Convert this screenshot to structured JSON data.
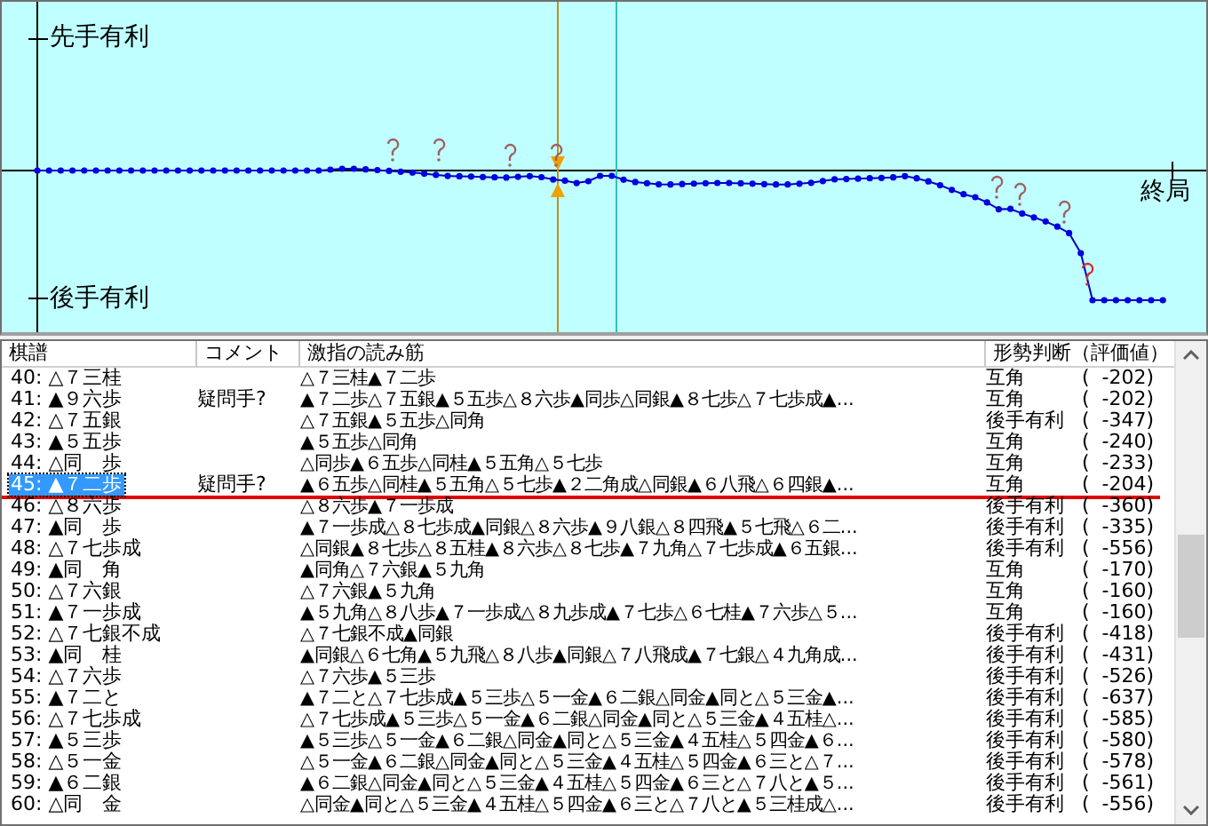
{
  "graph": {
    "upper_label": "先手有利",
    "lower_label": "後手有利",
    "end_label": "終局"
  },
  "table": {
    "columns": [
      "棋譜",
      "コメント",
      "激指の読み筋",
      "形勢判断（評価値）"
    ],
    "rows": [
      {
        "move": "40: △７三桂",
        "comment": "",
        "line": "△７三桂▲７二歩",
        "judgement": "互角",
        "value": "(  -202)",
        "selected": false,
        "current": false
      },
      {
        "move": "41: ▲９六歩",
        "comment": "疑問手?",
        "line": "▲７二歩△７五銀▲５五歩△８六歩▲同歩△同銀▲８七歩△７七歩成▲...",
        "judgement": "互角",
        "value": "(  -202)",
        "selected": false,
        "current": false
      },
      {
        "move": "42: △７五銀",
        "comment": "",
        "line": "△７五銀▲５五歩△同角",
        "judgement": "後手有利",
        "value": "(  -347)",
        "selected": false,
        "current": false
      },
      {
        "move": "43: ▲５五歩",
        "comment": "",
        "line": "▲５五歩△同角",
        "judgement": "互角",
        "value": "(  -240)",
        "selected": false,
        "current": false
      },
      {
        "move": "44: △同　歩",
        "comment": "",
        "line": "△同歩▲６五歩△同桂▲５五角△５七歩",
        "judgement": "互角",
        "value": "(  -233)",
        "selected": false,
        "current": false
      },
      {
        "move": "45: ▲７二歩",
        "comment": "疑問手?",
        "line": "▲６五歩△同桂▲５五角△５七歩▲２二角成△同銀▲６八飛△６四銀▲...",
        "judgement": "互角",
        "value": "(  -204)",
        "selected": true,
        "current": true
      },
      {
        "move": "46: △８六歩",
        "comment": "",
        "line": "△８六歩▲７一歩成",
        "judgement": "後手有利",
        "value": "(  -360)",
        "selected": false,
        "current": false
      },
      {
        "move": "47: ▲同　歩",
        "comment": "",
        "line": "▲７一歩成△８七歩成▲同銀△８六歩▲９八銀△８四飛▲５七飛△６二...",
        "judgement": "後手有利",
        "value": "(  -335)",
        "selected": false,
        "current": false
      },
      {
        "move": "48: △７七歩成",
        "comment": "",
        "line": "△同銀▲８七歩△８五桂▲８六歩△８七歩▲７九角△７七歩成▲６五銀...",
        "judgement": "後手有利",
        "value": "(  -556)",
        "selected": false,
        "current": false
      },
      {
        "move": "49: ▲同　角",
        "comment": "",
        "line": "▲同角△７六銀▲５九角",
        "judgement": "互角",
        "value": "(  -170)",
        "selected": false,
        "current": false
      },
      {
        "move": "50: △７六銀",
        "comment": "",
        "line": "△７六銀▲５九角",
        "judgement": "互角",
        "value": "(  -160)",
        "selected": false,
        "current": false
      },
      {
        "move": "51: ▲７一歩成",
        "comment": "",
        "line": "▲５九角△８八歩▲７一歩成△８九歩成▲７七歩△６七桂▲７六歩△５...",
        "judgement": "互角",
        "value": "(  -160)",
        "selected": false,
        "current": false
      },
      {
        "move": "52: △７七銀不成",
        "comment": "",
        "line": "△７七銀不成▲同銀",
        "judgement": "後手有利",
        "value": "(  -418)",
        "selected": false,
        "current": false
      },
      {
        "move": "53: ▲同　桂",
        "comment": "",
        "line": "▲同銀△６七角▲５九飛△８八歩▲同銀△７八飛成▲７七銀△４九角成...",
        "judgement": "後手有利",
        "value": "(  -431)",
        "selected": false,
        "current": false
      },
      {
        "move": "54: △７六歩",
        "comment": "",
        "line": "△７六歩▲５三歩",
        "judgement": "後手有利",
        "value": "(  -526)",
        "selected": false,
        "current": false
      },
      {
        "move": "55: ▲７二と",
        "comment": "",
        "line": "▲７二と△７七歩成▲５三歩△５一金▲６二銀△同金▲同と△５三金▲...",
        "judgement": "後手有利",
        "value": "(  -637)",
        "selected": false,
        "current": false
      },
      {
        "move": "56: △７七歩成",
        "comment": "",
        "line": "△７七歩成▲５三歩△５一金▲６二銀△同金▲同と△５三金▲４五桂△...",
        "judgement": "後手有利",
        "value": "(  -585)",
        "selected": false,
        "current": false
      },
      {
        "move": "57: ▲５三歩",
        "comment": "",
        "line": "▲５三歩△５一金▲６二銀△同金▲同と△５三金▲４五桂△５四金▲６...",
        "judgement": "後手有利",
        "value": "(  -580)",
        "selected": false,
        "current": false
      },
      {
        "move": "58: △５一金",
        "comment": "",
        "line": "△５一金▲６二銀△同金▲同と△５三金▲４五桂△５四金▲６三と△７...",
        "judgement": "後手有利",
        "value": "(  -578)",
        "selected": false,
        "current": false
      },
      {
        "move": "59: ▲６二銀",
        "comment": "",
        "line": "▲６二銀△同金▲同と△５三金▲４五桂△５四金▲６三と△７八と▲５...",
        "judgement": "後手有利",
        "value": "(  -561)",
        "selected": false,
        "current": false
      },
      {
        "move": "60: △同　金",
        "comment": "",
        "line": "△同金▲同と△５三金▲４五桂△５四金▲６三と△７八と▲５三桂成△...",
        "judgement": "後手有利",
        "value": "(  -556)",
        "selected": false,
        "current": false
      }
    ]
  }
}
